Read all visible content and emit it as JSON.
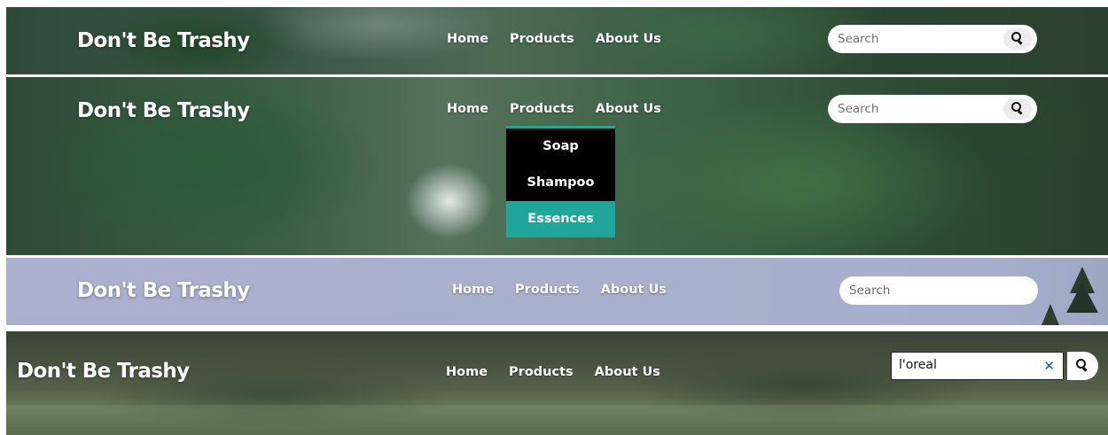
{
  "brand": {
    "name": "Don't Be Trashy"
  },
  "nav": {
    "home": "Home",
    "products": "Products",
    "about": "About Us"
  },
  "search": {
    "placeholder": "Search",
    "value": "l'oreal"
  },
  "dropdown": {
    "items": [
      "Soap",
      "Shampoo",
      "Essences"
    ],
    "active_item": "Essences"
  },
  "colors": {
    "accent": "#1fa59a",
    "dropdown_bg": "#000000",
    "nav_text": "#ffffff",
    "clear_icon": "#1f5fb0"
  },
  "icons": {
    "search": "magnifier-icon",
    "clear": "close-icon"
  }
}
